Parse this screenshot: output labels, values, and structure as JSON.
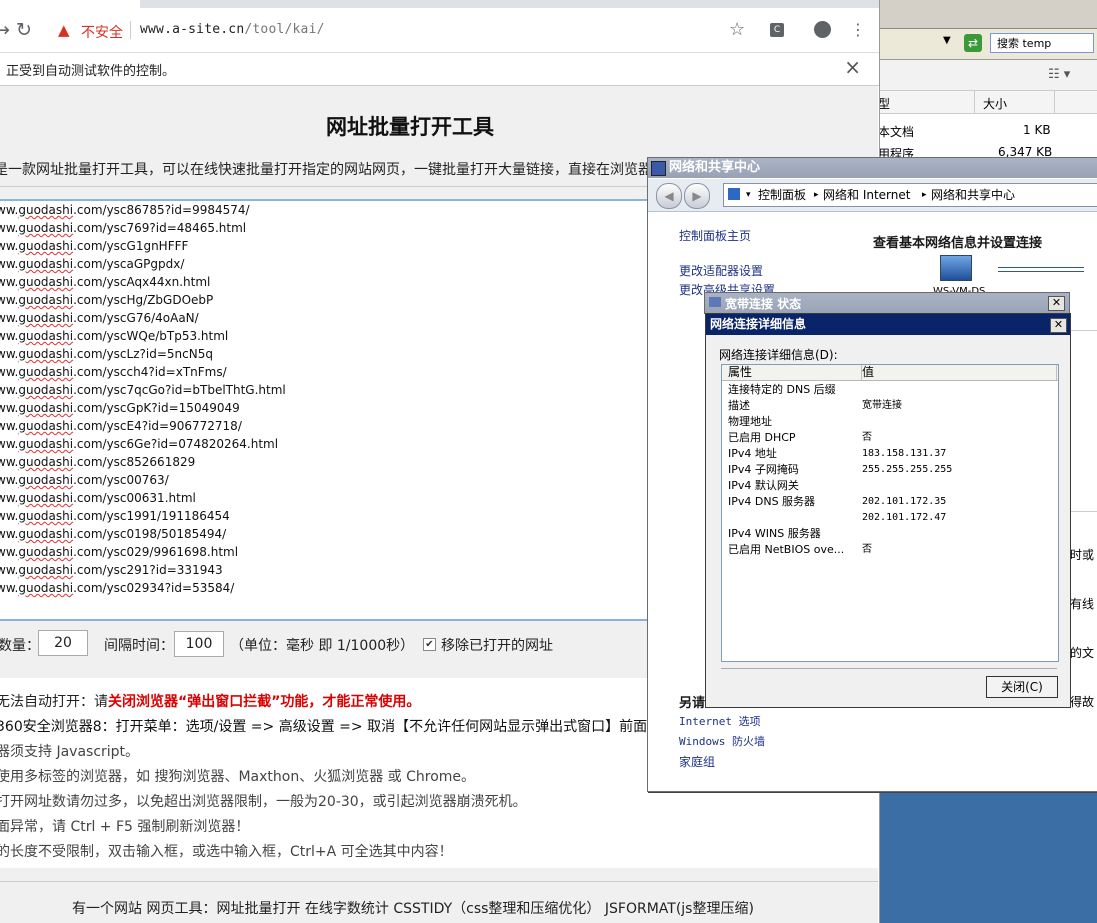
{
  "browser": {
    "address": {
      "warning_label": "不安全",
      "host": "www.a-site.cn",
      "path": "/tool/kai/"
    },
    "infobar": {
      "message": "正受到自动测试软件的控制。"
    },
    "icons": {
      "reload": "reload-icon",
      "warning": "warning-icon",
      "star": "bookmark-star-icon",
      "extension": "extension-icon",
      "profile": "profile-icon",
      "menu": "menu-icon",
      "close": "close-icon"
    }
  },
  "page": {
    "title": "网址批量打开工具",
    "intro": "是一款网址批量打开工具，可以在线快速批量打开指定的网站网页，一键批量打开大量链接，直接在浏览器",
    "url_lines": [
      {
        "pre": "ww.",
        "sq": "guodashi",
        "post": ".com/ysc86785?id=9984574/"
      },
      {
        "pre": "ww.",
        "sq": "guodashi",
        "post": ".com/ysc769?id=48465.html"
      },
      {
        "pre": "ww.",
        "sq": "guodashi",
        "post": ".com/yscG1gnHFFF"
      },
      {
        "pre": "ww.",
        "sq": "guodashi",
        "post": ".com/yscaGPgpdx/"
      },
      {
        "pre": "ww.",
        "sq": "guodashi",
        "post": ".com/yscAqx44xn.html"
      },
      {
        "pre": "ww.",
        "sq": "guodashi",
        "post": ".com/yscHg/ZbGDOebP"
      },
      {
        "pre": "ww.",
        "sq": "guodashi",
        "post": ".com/yscG76/4oAaN/"
      },
      {
        "pre": "ww.",
        "sq": "guodashi",
        "post": ".com/yscWQe/bTp53.html"
      },
      {
        "pre": "ww.",
        "sq": "guodashi",
        "post": ".com/yscLz?id=5ncN5q"
      },
      {
        "pre": "ww.",
        "sq": "guodashi",
        "post": ".com/yscch4?id=xTnFms/"
      },
      {
        "pre": "ww.",
        "sq": "guodashi",
        "post": ".com/ysc7qcGo?id=bTbelThtG.html"
      },
      {
        "pre": "ww.",
        "sq": "guodashi",
        "post": ".com/yscGpK?id=15049049"
      },
      {
        "pre": "ww.",
        "sq": "guodashi",
        "post": ".com/yscE4?id=906772718/"
      },
      {
        "pre": "ww.",
        "sq": "guodashi",
        "post": ".com/ysc6Ge?id=074820264.html"
      },
      {
        "pre": "ww.",
        "sq": "guodashi",
        "post": ".com/ysc852661829"
      },
      {
        "pre": "ww.",
        "sq": "guodashi",
        "post": ".com/ysc00763/"
      },
      {
        "pre": "ww.",
        "sq": "guodashi",
        "post": ".com/ysc00631.html"
      },
      {
        "pre": "ww.",
        "sq": "guodashi",
        "post": ".com/ysc1991/191186454"
      },
      {
        "pre": "ww.",
        "sq": "guodashi",
        "post": ".com/ysc0198/50185494/"
      },
      {
        "pre": "ww.",
        "sq": "guodashi",
        "post": ".com/ysc029/9961698.html"
      },
      {
        "pre": "ww.",
        "sq": "guodashi",
        "post": ".com/ysc291?id=331943"
      },
      {
        "pre": "ww.",
        "sq": "guodashi",
        "post": ".com/ysc02934?id=53584/"
      }
    ],
    "controls": {
      "count_label": "数量：",
      "count_value": "20",
      "interval_label": "间隔时间：",
      "interval_value": "100",
      "unit_note": "（单位：毫秒 即 1/1000秒）",
      "remove_opened_label": "移除已打开的网址",
      "remove_opened_checked": true
    },
    "notes": {
      "line1_prefix": "无法自动打开：请",
      "line1_red": "关闭浏览器“弹出窗口拦截”功能，才能正常使用。",
      "line2": "360安全浏览器8：打开菜单：选项/设置 => 高级设置 => 取消【不允许任何网站显示弹出式窗口】前面的",
      "line3": "器须支持 Javascript。",
      "line4": "使用多标签的浏览器，如 搜狗浏览器、Maxthon、火狐浏览器 或 Chrome。",
      "line5": "打开网址数请勿过多，以免超出浏览器限制，一般为20-30，或引起浏览器崩溃死机。",
      "line6": "面异常，请 Ctrl + F5 强制刷新浏览器！",
      "line7": "的长度不受限制，双击输入框，或选中输入框，Ctrl+A 可全选其中内容！"
    },
    "footer": "有一个网站 网页工具：网址批量打开 在线字数统计 CSSTIDY（css整理和压缩优化） JSFORMAT(js整理压缩)"
  },
  "explorer": {
    "search_placeholder": "搜索 temp",
    "columns": {
      "type_frag": "型",
      "size": "大小"
    },
    "rows": [
      {
        "type": "本文档",
        "size": "1 KB"
      },
      {
        "type": "用程序",
        "size": "6,347 KB"
      }
    ]
  },
  "network_center": {
    "title": "网络和共享中心",
    "breadcrumb": [
      "控制面板",
      "网络和 Internet",
      "网络和共享中心"
    ],
    "left_links": [
      "控制面板主页",
      "更改适配器设置",
      "更改高级共享设置"
    ],
    "heading": "查看基本网络信息并设置连接",
    "computer_label_frag": "WS-VM-DS",
    "see_also": "另请",
    "see_also_links": [
      "Internet 选项",
      "Windows 防火墙",
      "家庭组"
    ],
    "side_frags": [
      "时或",
      "有线",
      "的文",
      "得故"
    ]
  },
  "status_dialog": {
    "title": "宽带连接 状态"
  },
  "details_dialog": {
    "title": "网络连接详细信息",
    "label": "网络连接详细信息(D):",
    "col_property": "属性",
    "col_value": "值",
    "rows": [
      {
        "k": "连接特定的 DNS 后缀",
        "v": ""
      },
      {
        "k": "描述",
        "v": "宽带连接"
      },
      {
        "k": "物理地址",
        "v": ""
      },
      {
        "k": "已启用 DHCP",
        "v": "否"
      },
      {
        "k": "IPv4 地址",
        "v": "183.158.131.37"
      },
      {
        "k": "IPv4 子网掩码",
        "v": "255.255.255.255"
      },
      {
        "k": "IPv4 默认网关",
        "v": ""
      },
      {
        "k": "IPv4 DNS 服务器",
        "v": "202.101.172.35"
      },
      {
        "k": "",
        "v": "202.101.172.47"
      },
      {
        "k": "IPv4 WINS 服务器",
        "v": ""
      },
      {
        "k": "已启用 NetBIOS ove...",
        "v": "否"
      }
    ],
    "close_label": "关闭(C)"
  }
}
